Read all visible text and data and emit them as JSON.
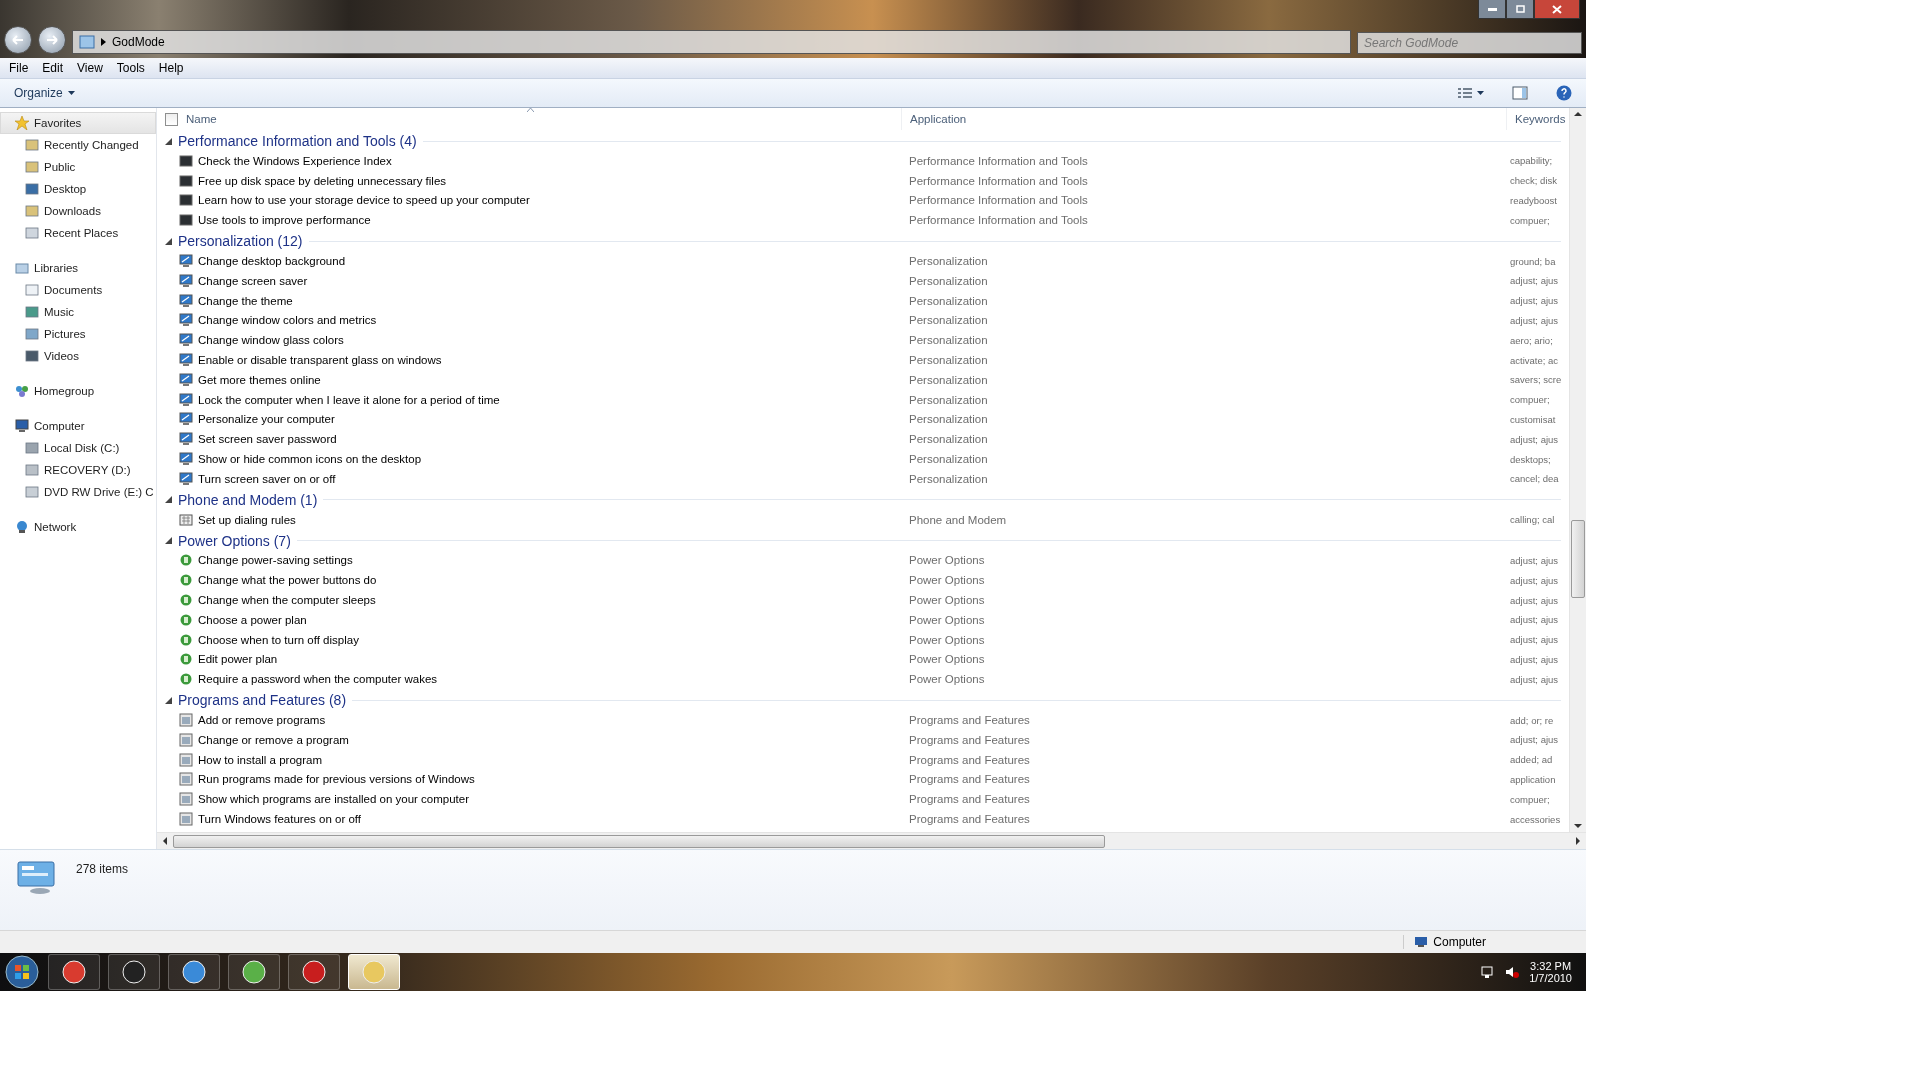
{
  "window": {
    "location": "GodMode",
    "search": {
      "placeholder": "Search GodMode"
    }
  },
  "menu": [
    "File",
    "Edit",
    "View",
    "Tools",
    "Help"
  ],
  "toolbar": {
    "organize": "Organize"
  },
  "sidebar": [
    {
      "label": "Favorites",
      "selected": true,
      "children": [
        {
          "label": "Recently Changed",
          "selected": false
        },
        {
          "label": "Public",
          "selected": false
        },
        {
          "label": "Desktop",
          "selected": false
        },
        {
          "label": "Downloads",
          "selected": false
        },
        {
          "label": "Recent Places",
          "selected": false
        }
      ]
    },
    {
      "label": "Libraries",
      "selected": false,
      "children": [
        {
          "label": "Documents",
          "selected": false
        },
        {
          "label": "Music",
          "selected": false
        },
        {
          "label": "Pictures",
          "selected": false
        },
        {
          "label": "Videos",
          "selected": false
        }
      ]
    },
    {
      "label": "Homegroup",
      "selected": false
    },
    {
      "label": "Computer",
      "selected": false,
      "children": [
        {
          "label": "Local Disk (C:)",
          "selected": false
        },
        {
          "label": "RECOVERY (D:)",
          "selected": false
        },
        {
          "label": "DVD RW Drive (E:) C",
          "selected": false
        }
      ]
    },
    {
      "label": "Network",
      "selected": false
    }
  ],
  "columns": {
    "checked": false,
    "items": [
      "Name",
      "Application",
      "Keywords"
    ]
  },
  "groups": [
    {
      "title": "Performance Information and Tools (4)",
      "expanded": true,
      "items": [
        {
          "name": "Check the Windows Experience Index",
          "application": "Performance Information and Tools",
          "keywords": "capability;"
        },
        {
          "name": "Free up disk space by deleting unnecessary files",
          "application": "Performance Information and Tools",
          "keywords": "check; disk"
        },
        {
          "name": "Learn how to use your storage device to speed up your computer",
          "application": "Performance Information and Tools",
          "keywords": "readyboost"
        },
        {
          "name": "Use tools to improve performance",
          "application": "Performance Information and Tools",
          "keywords": "compuer;"
        }
      ]
    },
    {
      "title": "Personalization (12)",
      "expanded": true,
      "items": [
        {
          "name": "Change desktop background",
          "application": "Personalization",
          "keywords": "ground; ba"
        },
        {
          "name": "Change screen saver",
          "application": "Personalization",
          "keywords": "adjust; ajus"
        },
        {
          "name": "Change the theme",
          "application": "Personalization",
          "keywords": "adjust; ajus"
        },
        {
          "name": "Change window colors and metrics",
          "application": "Personalization",
          "keywords": "adjust; ajus"
        },
        {
          "name": "Change window glass colors",
          "application": "Personalization",
          "keywords": "aero; ario;"
        },
        {
          "name": "Enable or disable transparent glass on windows",
          "application": "Personalization",
          "keywords": "activate; ac"
        },
        {
          "name": "Get more themes online",
          "application": "Personalization",
          "keywords": "savers; scre"
        },
        {
          "name": "Lock the computer when I leave it alone for a period of time",
          "application": "Personalization",
          "keywords": "compuer;"
        },
        {
          "name": "Personalize your computer",
          "application": "Personalization",
          "keywords": "customisat"
        },
        {
          "name": "Set screen saver password",
          "application": "Personalization",
          "keywords": "adjust; ajus"
        },
        {
          "name": "Show or hide common icons on the desktop",
          "application": "Personalization",
          "keywords": "desktops;"
        },
        {
          "name": "Turn screen saver on or off",
          "application": "Personalization",
          "keywords": "cancel; dea"
        }
      ]
    },
    {
      "title": "Phone and Modem (1)",
      "expanded": true,
      "items": [
        {
          "name": "Set up dialing rules",
          "application": "Phone and Modem",
          "keywords": "calling; cal"
        }
      ]
    },
    {
      "title": "Power Options (7)",
      "expanded": true,
      "items": [
        {
          "name": "Change power-saving settings",
          "application": "Power Options",
          "keywords": "adjust; ajus"
        },
        {
          "name": "Change what the power buttons do",
          "application": "Power Options",
          "keywords": "adjust; ajus"
        },
        {
          "name": "Change when the computer sleeps",
          "application": "Power Options",
          "keywords": "adjust; ajus"
        },
        {
          "name": "Choose a power plan",
          "application": "Power Options",
          "keywords": "adjust; ajus"
        },
        {
          "name": "Choose when to turn off display",
          "application": "Power Options",
          "keywords": "adjust; ajus"
        },
        {
          "name": "Edit power plan",
          "application": "Power Options",
          "keywords": "adjust; ajus"
        },
        {
          "name": "Require a password when the computer wakes",
          "application": "Power Options",
          "keywords": "adjust; ajus"
        }
      ]
    },
    {
      "title": "Programs and Features (8)",
      "expanded": true,
      "items": [
        {
          "name": "Add or remove programs",
          "application": "Programs and Features",
          "keywords": "add; or; re"
        },
        {
          "name": "Change or remove a program",
          "application": "Programs and Features",
          "keywords": "adjust; ajus"
        },
        {
          "name": "How to install a program",
          "application": "Programs and Features",
          "keywords": "added; ad"
        },
        {
          "name": "Run programs made for previous versions of Windows",
          "application": "Programs and Features",
          "keywords": "application"
        },
        {
          "name": "Show which programs are installed on your computer",
          "application": "Programs and Features",
          "keywords": "compuer;"
        },
        {
          "name": "Turn Windows features on or off",
          "application": "Programs and Features",
          "keywords": "accessories"
        }
      ]
    }
  ],
  "details": {
    "count": "278 items"
  },
  "status_bar": {
    "location": "Computer"
  },
  "taskbar": {
    "apps": [
      {
        "selected": false
      },
      {
        "selected": false
      },
      {
        "selected": false
      },
      {
        "selected": false
      },
      {
        "selected": false
      },
      {
        "selected": true
      }
    ],
    "time": "3:32 PM",
    "date": "1/7/2010"
  }
}
